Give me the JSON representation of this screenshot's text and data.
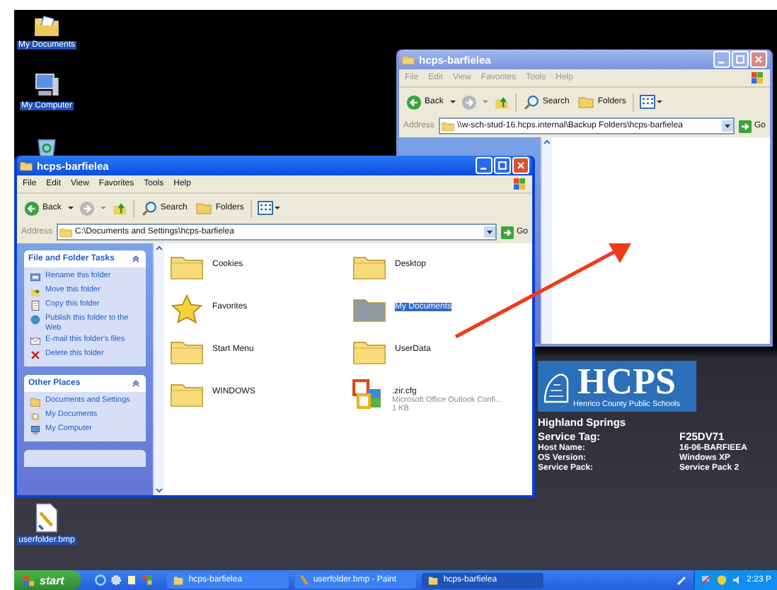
{
  "desktop_icons": [
    {
      "label": "My Documents",
      "kind": "documents",
      "selected": true
    },
    {
      "kind": "computer",
      "label": "My Computer",
      "selected": true
    },
    {
      "kind": "recycle"
    },
    {
      "kind": "bitmap",
      "label": "userfolder.bmp",
      "selected": true
    }
  ],
  "windows": [
    {
      "title": "hcps-barfielea",
      "active": false,
      "menu": [
        "File",
        "Edit",
        "View",
        "Favorites",
        "Tools",
        "Help"
      ],
      "back": "Back",
      "search": "Search",
      "folders": "Folders",
      "address_label": "Address",
      "address": "\\\\w-sch-stud-16.hcps.internal\\Backup Folders\\hcps-barfielea",
      "go": "Go"
    },
    {
      "title": "hcps-barfielea",
      "active": true,
      "menu": [
        "File",
        "Edit",
        "View",
        "Favorites",
        "Tools",
        "Help"
      ],
      "back": "Back",
      "search": "Search",
      "folders": "Folders",
      "address_label": "Address",
      "address": "C:\\Documents and Settings\\hcps-barfielea",
      "go": "Go",
      "task_panes": [
        {
          "title": "File and Folder Tasks",
          "items": [
            {
              "kind": "rename",
              "label": "Rename this folder"
            },
            {
              "kind": "move",
              "label": "Move this folder"
            },
            {
              "kind": "copy",
              "label": "Copy this folder"
            },
            {
              "kind": "publish",
              "label": "Publish this folder to the Web"
            },
            {
              "kind": "email",
              "label": "E-mail this folder's files"
            },
            {
              "kind": "delete",
              "label": "Delete this folder"
            }
          ]
        },
        {
          "title": "Other Places",
          "items": [
            {
              "kind": "folder",
              "label": "Documents and Settings"
            },
            {
              "kind": "documents",
              "label": "My Documents"
            },
            {
              "kind": "computer",
              "label": "My Computer"
            }
          ]
        }
      ],
      "items": [
        {
          "kind": "folder",
          "name": "Cookies",
          "selected": false
        },
        {
          "kind": "folder",
          "name": "Desktop",
          "selected": false
        },
        {
          "kind": "favorites",
          "name": "Favorites",
          "selected": false
        },
        {
          "kind": "shared",
          "name": "My Documents",
          "selected": true
        },
        {
          "kind": "folder",
          "name": "Start Menu",
          "selected": false
        },
        {
          "kind": "folder",
          "name": "UserData",
          "selected": false
        },
        {
          "kind": "folder",
          "name": "WINDOWS",
          "selected": false
        },
        {
          "kind": "file",
          "name": ".zir.cfg",
          "type": "Microsoft Office Outlook Confi...",
          "size": "1 KB",
          "selected": false
        }
      ]
    }
  ],
  "info_panel": {
    "logo_title": "HCPS",
    "logo_subtitle": "Henrico County Public Schools",
    "location": "Highland Springs",
    "service_tag_label": "Service Tag:",
    "service_tag": "F25DV71",
    "rows": [
      {
        "label": "Host Name:",
        "value": "16-06-BARFIEEA"
      },
      {
        "label": "OS Version:",
        "value": "Windows XP"
      },
      {
        "label": "Service Pack:",
        "value": "Service Pack 2"
      }
    ]
  },
  "taskbar": {
    "start": "start",
    "tasks": [
      {
        "label": "hcps-barfielea",
        "kind": "folder",
        "selected": false
      },
      {
        "label": "userfolder.bmp - Paint",
        "kind": "paint",
        "selected": false
      },
      {
        "label": "hcps-barfielea",
        "kind": "folder",
        "selected": true
      }
    ],
    "clock": "2:23 P"
  }
}
